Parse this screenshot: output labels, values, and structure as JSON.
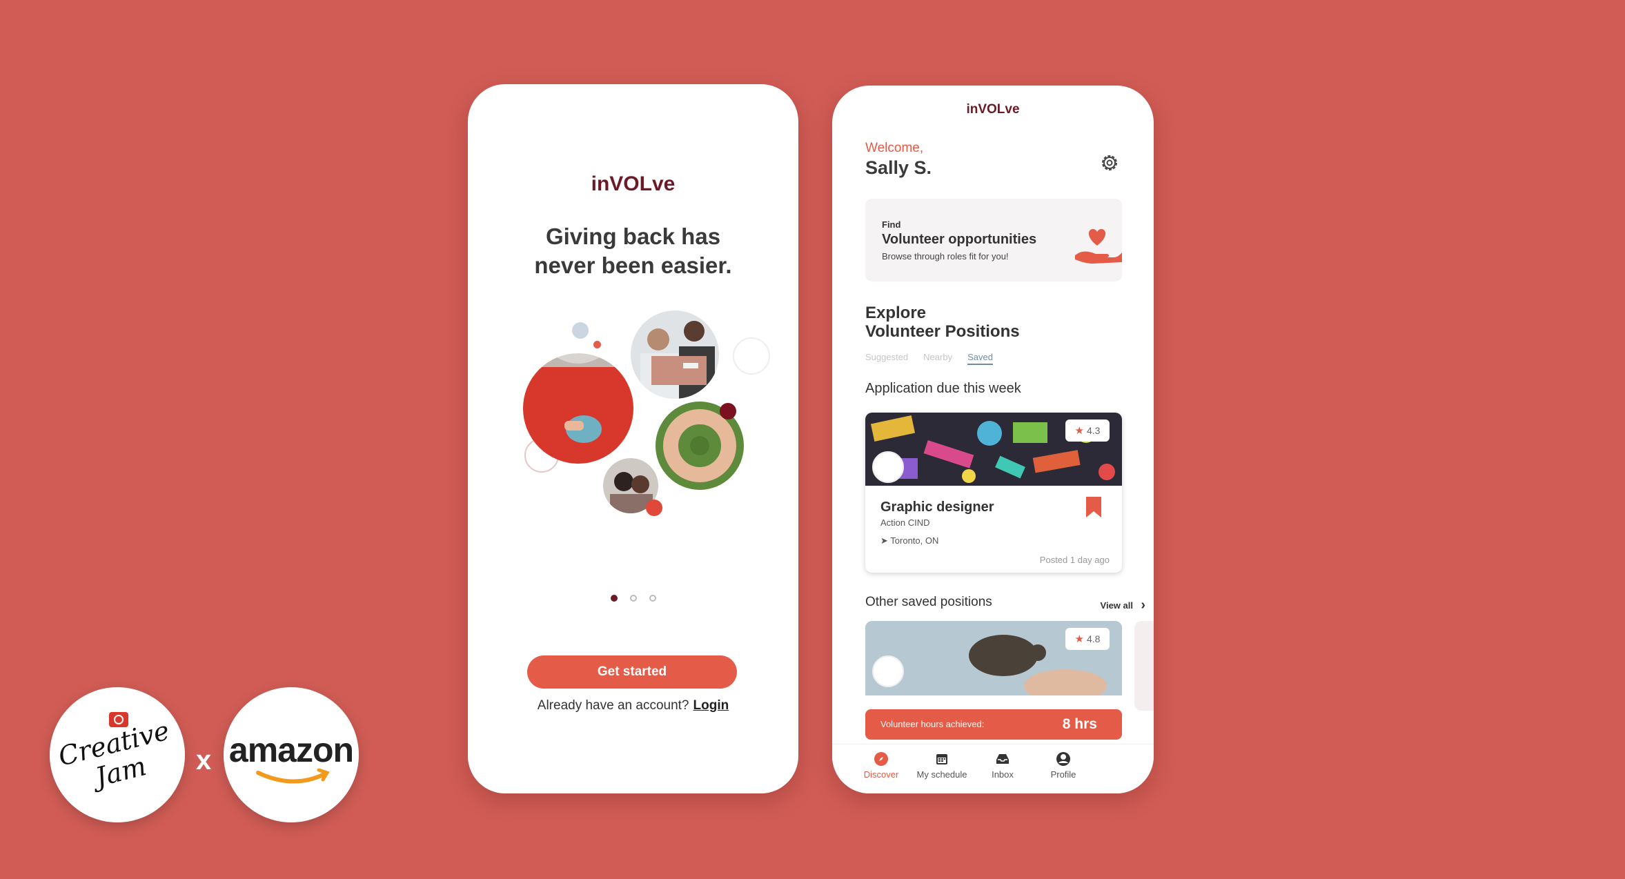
{
  "colors": {
    "background": "#d05c55",
    "accent": "#e45b47",
    "brand": "#6b1a26"
  },
  "onboarding": {
    "brand": "inVOLve",
    "headline_line1": "Giving back has",
    "headline_line2": "never been easier.",
    "pager": {
      "pages": 3,
      "active": 1
    },
    "cta_label": "Get started",
    "account_prompt": "Already have an account?",
    "login_label": "Login"
  },
  "home": {
    "brand": "inVOLve",
    "welcome": "Welcome,",
    "user_name": "Sally S.",
    "find_card": {
      "small": "Find",
      "title": "Volunteer opportunities",
      "subtitle": "Browse through roles fit for you!"
    },
    "explore_line1": "Explore",
    "explore_line2": "Volunteer Positions",
    "tabs": [
      "Suggested",
      "Nearby",
      "Saved"
    ],
    "active_tab": "Saved",
    "due_heading": "Application due this week",
    "job": {
      "rating": "4.3",
      "title": "Graphic designer",
      "org": "Action CIND",
      "location": "Toronto, ON",
      "posted": "Posted 1 day ago"
    },
    "other_heading": "Other saved positions",
    "view_all": "View all",
    "saved_card": {
      "rating": "4.8",
      "hours_label": "Volunteer hours achieved:",
      "hours_value": "8 hrs"
    },
    "nav": [
      {
        "label": "Discover",
        "icon": "compass-icon",
        "active": true
      },
      {
        "label": "My schedule",
        "icon": "calendar-icon",
        "active": false
      },
      {
        "label": "Inbox",
        "icon": "inbox-icon",
        "active": false
      },
      {
        "label": "Profile",
        "icon": "profile-icon",
        "active": false
      }
    ]
  },
  "logos": {
    "creative_jam_line1": "Creative",
    "creative_jam_line2": "Jam",
    "separator": "x",
    "amazon": "amazon"
  }
}
